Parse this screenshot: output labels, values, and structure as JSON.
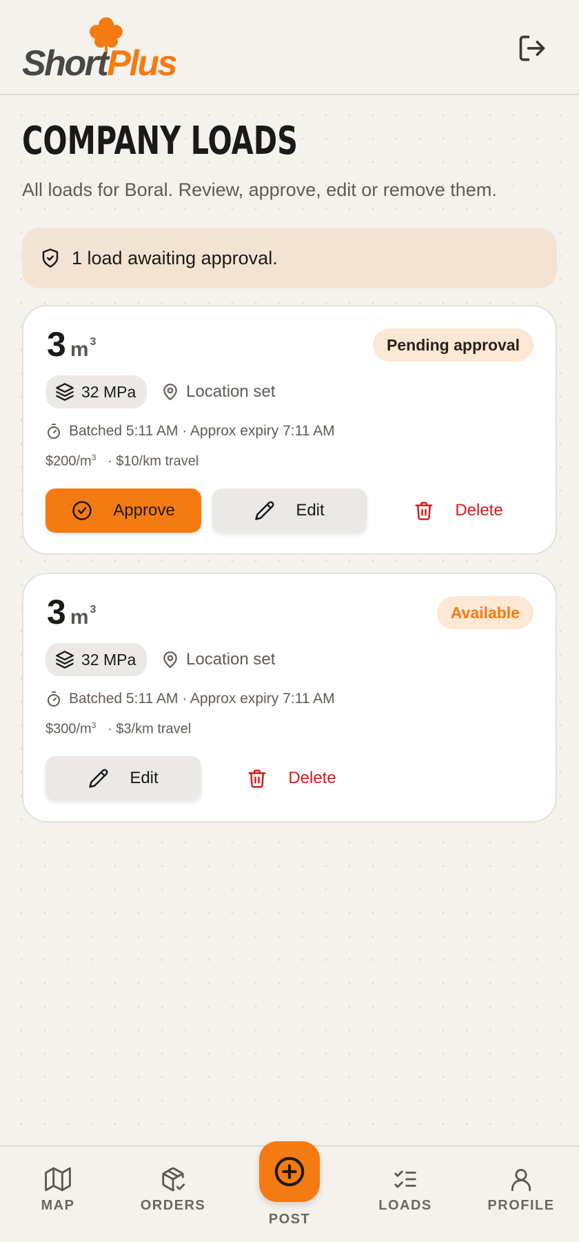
{
  "brand": {
    "name_part1": "Short",
    "name_part2": "Plus",
    "accent": "#f47b12"
  },
  "header": {
    "logout_icon": "logout-icon"
  },
  "page": {
    "title": "COMPANY LOADS",
    "subtitle": "All loads for Boral. Review, approve, edit or remove them."
  },
  "notice": {
    "icon": "shield-check-icon",
    "text": "1 load awaiting approval."
  },
  "loads": [
    {
      "quantity": "3",
      "unit": "m",
      "unit_sup": "3",
      "status": "Pending approval",
      "strength": "32 MPa",
      "location": "Location set",
      "batch_info": "Batched 5:11 AM · Approx expiry 7:11 AM",
      "price": "$200/m",
      "price_sup": "3",
      "travel": "· $10/km travel",
      "approve_label": "Approve",
      "edit_label": "Edit",
      "delete_label": "Delete"
    },
    {
      "quantity": "3",
      "unit": "m",
      "unit_sup": "3",
      "status": "Available",
      "strength": "32 MPa",
      "location": "Location set",
      "batch_info": "Batched 5:11 AM · Approx expiry 7:11 AM",
      "price": "$300/m",
      "price_sup": "3",
      "travel": "· $3/km travel",
      "edit_label": "Edit",
      "delete_label": "Delete"
    }
  ],
  "nav": {
    "items": [
      {
        "label": "MAP",
        "icon": "map-icon"
      },
      {
        "label": "ORDERS",
        "icon": "package-check-icon"
      },
      {
        "label": "POST",
        "icon": "plus-circle-icon"
      },
      {
        "label": "LOADS",
        "icon": "list-checks-icon"
      },
      {
        "label": "PROFILE",
        "icon": "user-icon"
      }
    ]
  },
  "colors": {
    "danger": "#d8191c",
    "background": "#f5f2ee",
    "pending_badge_bg": "#fbe8d4"
  }
}
